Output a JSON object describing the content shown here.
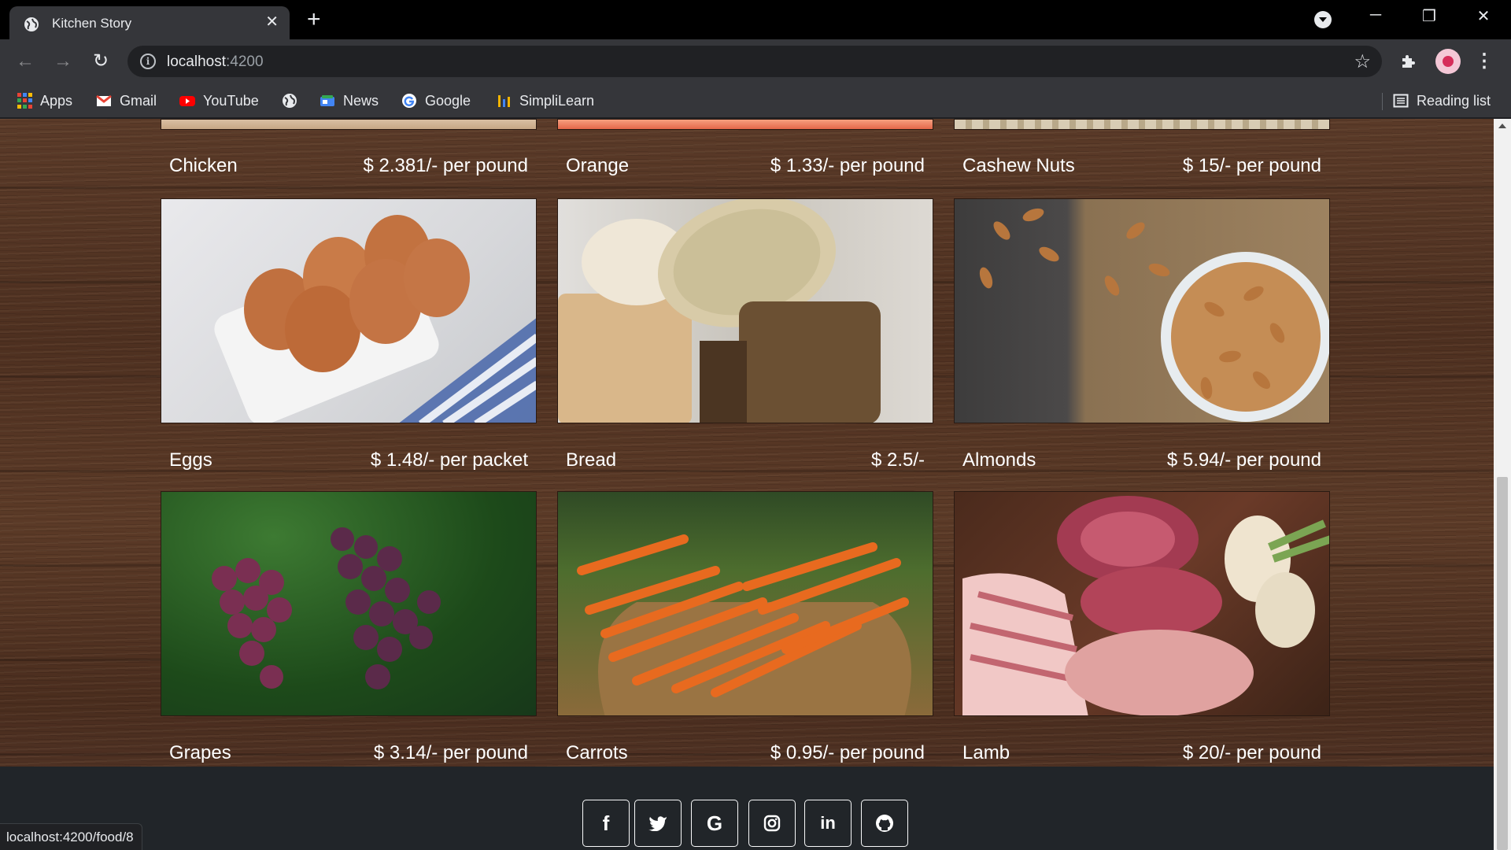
{
  "tab": {
    "title": "Kitchen Story",
    "close": "✕"
  },
  "window": {
    "minimize": "─",
    "restore": "❐",
    "close": "✕"
  },
  "address": {
    "host": "localhost",
    "port": ":4200"
  },
  "bookmarks": [
    {
      "label": "Apps",
      "icon": "apps-grid-icon"
    },
    {
      "label": "Gmail",
      "icon": "gmail-icon"
    },
    {
      "label": "YouTube",
      "icon": "youtube-icon"
    },
    {
      "label": "",
      "icon": "globe-icon"
    },
    {
      "label": "News",
      "icon": "news-icon"
    },
    {
      "label": "Google",
      "icon": "google-icon"
    },
    {
      "label": "SimpliLearn",
      "icon": "simplilearn-icon"
    }
  ],
  "reading_list": "Reading list",
  "products": [
    {
      "name": "Chicken",
      "price": "$ 2.381/- per pound"
    },
    {
      "name": "Orange",
      "price": "$ 1.33/- per pound"
    },
    {
      "name": "Cashew Nuts",
      "price": "$ 15/- per pound"
    },
    {
      "name": "Eggs",
      "price": "$ 1.48/- per packet"
    },
    {
      "name": "Bread",
      "price": "$ 2.5/-"
    },
    {
      "name": "Almonds",
      "price": "$ 5.94/- per pound"
    },
    {
      "name": "Grapes",
      "price": "$ 3.14/- per pound"
    },
    {
      "name": "Carrots",
      "price": "$ 0.95/- per pound"
    },
    {
      "name": "Lamb",
      "price": "$ 20/- per pound"
    }
  ],
  "social": [
    {
      "name": "facebook",
      "glyph": "f"
    },
    {
      "name": "twitter",
      "glyph": "🐦"
    },
    {
      "name": "google",
      "glyph": "G"
    },
    {
      "name": "instagram",
      "glyph": "◎"
    },
    {
      "name": "linkedin",
      "glyph": "in"
    },
    {
      "name": "github",
      "glyph": "⊙"
    }
  ],
  "status_url": "localhost:4200/food/8",
  "colors": {
    "tab_bg": "#35363a",
    "chrome_black": "#000000",
    "footer": "#212529"
  }
}
